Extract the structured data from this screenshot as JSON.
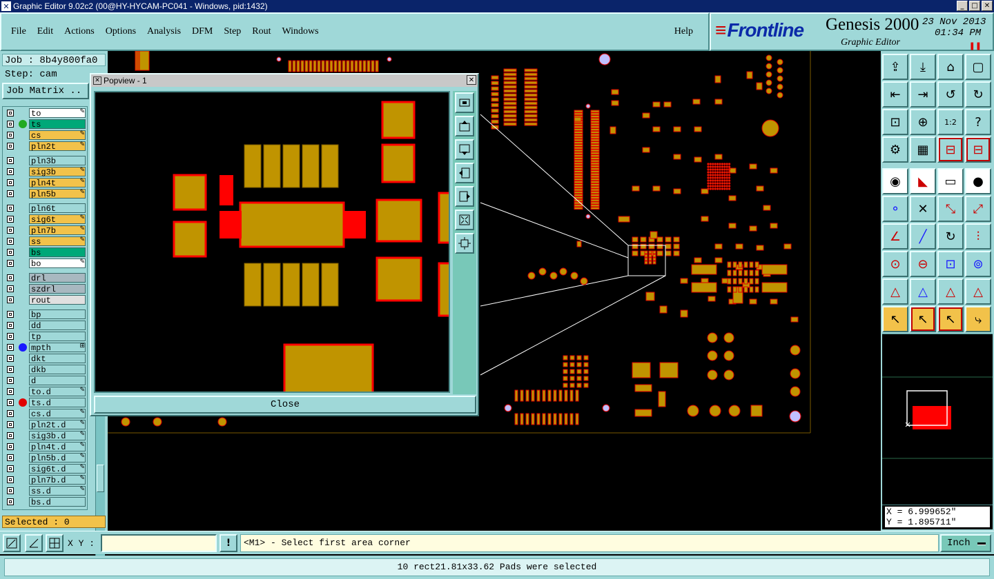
{
  "window": {
    "title": "Graphic Editor 9.02c2 (00@HY-HYCAM-PC041 - Windows, pid:1432)"
  },
  "menu": [
    "File",
    "Edit",
    "Actions",
    "Options",
    "Analysis",
    "DFM",
    "Step",
    "Rout",
    "Windows"
  ],
  "help_label": "Help",
  "brand": {
    "logo": "Frontline",
    "product": "Genesis 2000",
    "subtitle": "Graphic Editor",
    "date": "23 Nov 2013",
    "time": "01:34 PM"
  },
  "left": {
    "job": "Job : 8b4y800fa0",
    "step": "Step: cam",
    "job_matrix": "Job Matrix ..",
    "selected": "Selected : 0"
  },
  "layers": [
    {
      "name": "to",
      "bg": "#ffffff",
      "dot": "",
      "flag": "✎"
    },
    {
      "name": "ts",
      "bg": "#00a878",
      "dot": "#22aa22",
      "flag": ""
    },
    {
      "name": "cs",
      "bg": "#f2c24a",
      "dot": "",
      "flag": "✎"
    },
    {
      "name": "pln2t",
      "bg": "#f2c24a",
      "dot": "",
      "flag": "✎"
    },
    {
      "name": "pln3b",
      "bg": "#9fd8d8",
      "dot": "",
      "flag": ""
    },
    {
      "name": "sig3b",
      "bg": "#f2c24a",
      "dot": "",
      "flag": "✎"
    },
    {
      "name": "pln4t",
      "bg": "#f2c24a",
      "dot": "",
      "flag": "✎"
    },
    {
      "name": "pln5b",
      "bg": "#f2c24a",
      "dot": "",
      "flag": "✎"
    },
    {
      "name": "pln6t",
      "bg": "#9fd8d8",
      "dot": "",
      "flag": ""
    },
    {
      "name": "sig6t",
      "bg": "#f2c24a",
      "dot": "",
      "flag": "✎"
    },
    {
      "name": "pln7b",
      "bg": "#f2c24a",
      "dot": "",
      "flag": "✎"
    },
    {
      "name": "ss",
      "bg": "#f2c24a",
      "dot": "",
      "flag": "✎"
    },
    {
      "name": "bs",
      "bg": "#00a878",
      "dot": "",
      "flag": ""
    },
    {
      "name": "bo",
      "bg": "#ffffff",
      "dot": "",
      "flag": "✎"
    },
    {
      "name": "drl",
      "bg": "#a8b8c0",
      "dot": "",
      "flag": ""
    },
    {
      "name": "szdrl",
      "bg": "#a8b8c0",
      "dot": "",
      "flag": ""
    },
    {
      "name": "rout",
      "bg": "#e0e0e0",
      "dot": "",
      "flag": ""
    },
    {
      "name": "bp",
      "bg": "#9fd8d8",
      "dot": "",
      "flag": ""
    },
    {
      "name": "dd",
      "bg": "#9fd8d8",
      "dot": "",
      "flag": ""
    },
    {
      "name": "tp",
      "bg": "#9fd8d8",
      "dot": "",
      "flag": ""
    },
    {
      "name": "mpth",
      "bg": "#9fd8d8",
      "dot": "#1a1aff",
      "flag": "⊞"
    },
    {
      "name": "dkt",
      "bg": "#9fd8d8",
      "dot": "",
      "flag": ""
    },
    {
      "name": "dkb",
      "bg": "#9fd8d8",
      "dot": "",
      "flag": ""
    },
    {
      "name": "d",
      "bg": "#9fd8d8",
      "dot": "",
      "flag": ""
    },
    {
      "name": "to.d",
      "bg": "#9fd8d8",
      "dot": "",
      "flag": "✎"
    },
    {
      "name": "ts.d",
      "bg": "#9fd8d8",
      "dot": "#e00000",
      "flag": ""
    },
    {
      "name": "cs.d",
      "bg": "#9fd8d8",
      "dot": "",
      "flag": "✎"
    },
    {
      "name": "pln2t.d",
      "bg": "#9fd8d8",
      "dot": "",
      "flag": "✎"
    },
    {
      "name": "sig3b.d",
      "bg": "#9fd8d8",
      "dot": "",
      "flag": "✎"
    },
    {
      "name": "pln4t.d",
      "bg": "#9fd8d8",
      "dot": "",
      "flag": "✎"
    },
    {
      "name": "pln5b.d",
      "bg": "#9fd8d8",
      "dot": "",
      "flag": "✎"
    },
    {
      "name": "sig6t.d",
      "bg": "#9fd8d8",
      "dot": "",
      "flag": "✎"
    },
    {
      "name": "pln7b.d",
      "bg": "#9fd8d8",
      "dot": "",
      "flag": "✎"
    },
    {
      "name": "ss.d",
      "bg": "#9fd8d8",
      "dot": "",
      "flag": "✎"
    },
    {
      "name": "bs.d",
      "bg": "#9fd8d8",
      "dot": "",
      "flag": ""
    }
  ],
  "popview": {
    "title": "Popview - 1",
    "close_label": "Close"
  },
  "coords": {
    "x": "X = 6.999652\"",
    "y": "Y = 1.895711\""
  },
  "cmd": {
    "xy_label": "X Y :",
    "xy_value": "",
    "prompt": "<M1> - Select first area corner",
    "unit": "Inch"
  },
  "status": "10 rect21.81x33.62 Pads were selected",
  "colors": {
    "panel": "#9fd8d8",
    "pad": "#c09400",
    "highlight": "#ff0000",
    "title_blue": "#0a246a"
  }
}
